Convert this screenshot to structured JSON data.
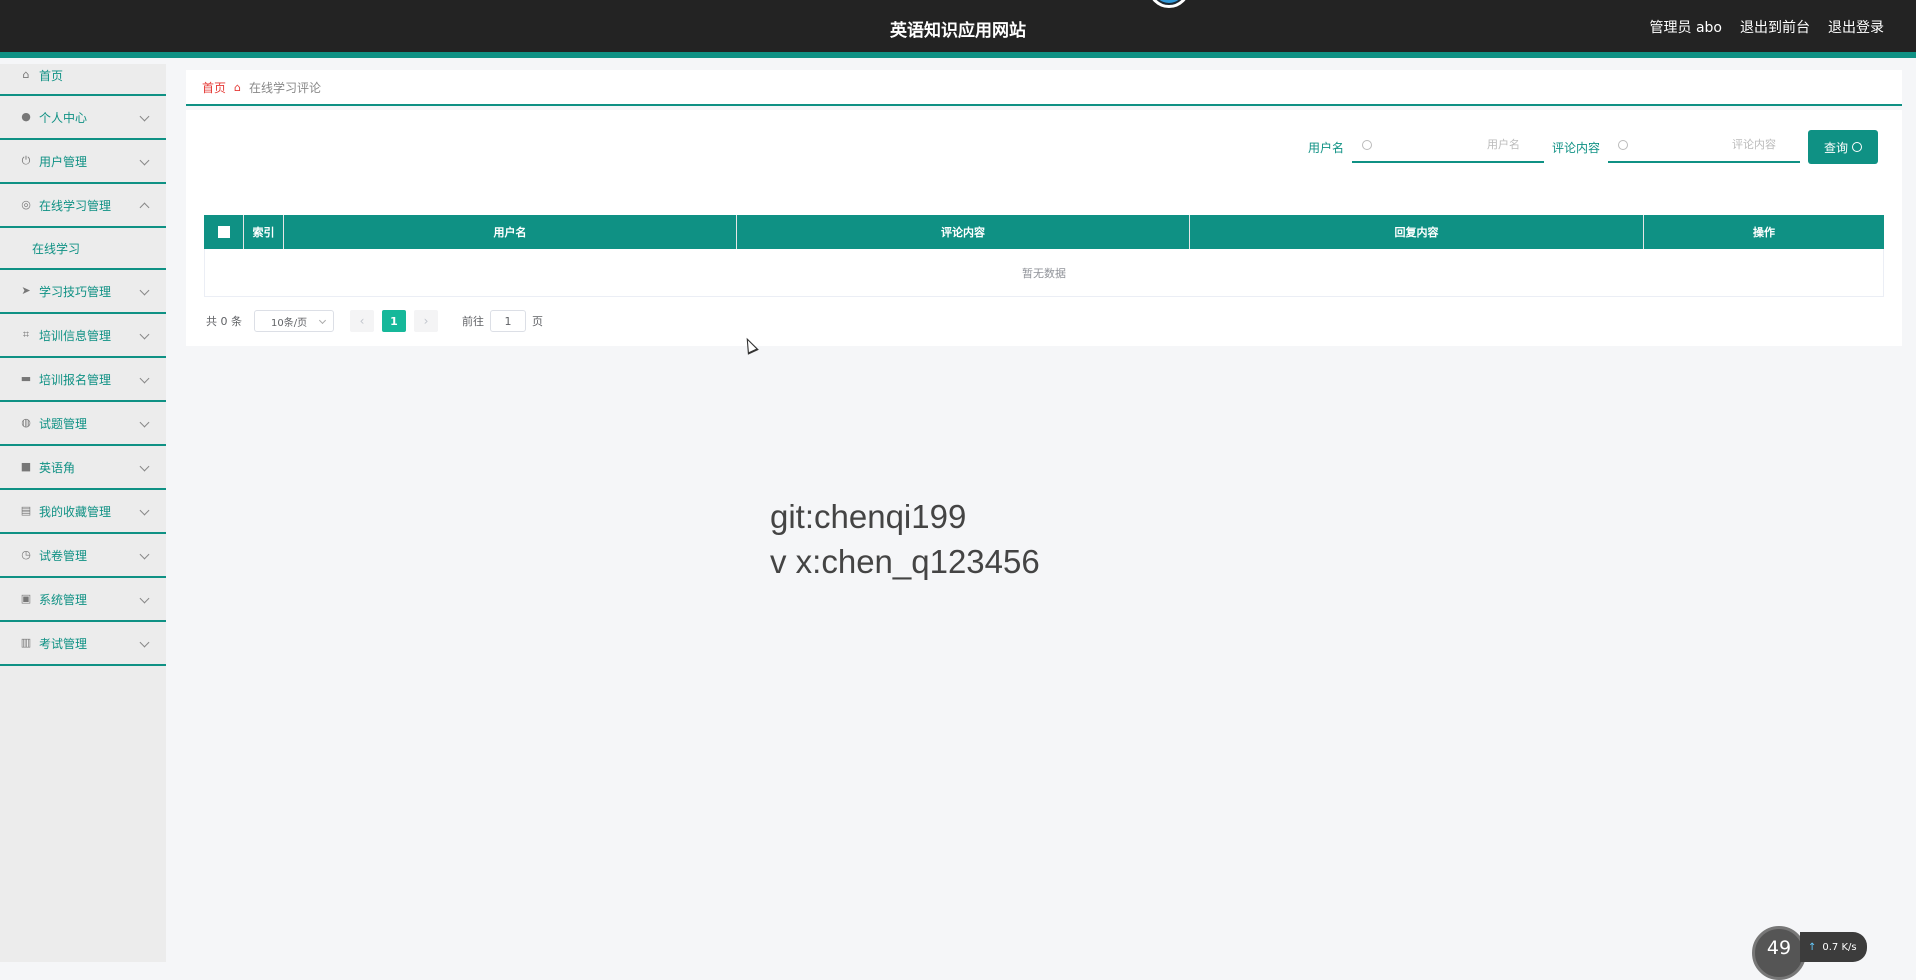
{
  "header": {
    "title": "英语知识应用网站",
    "user": "管理员 abo",
    "back_front": "退出到前台",
    "logout": "退出登录"
  },
  "sidebar": {
    "items": [
      {
        "label": "首页",
        "icon": "home-icon"
      },
      {
        "label": "个人中心",
        "icon": "user-icon"
      },
      {
        "label": "用户管理",
        "icon": "power-icon"
      },
      {
        "label": "在线学习管理",
        "icon": "compass-icon",
        "expanded": true
      },
      {
        "label": "学习技巧管理",
        "icon": "send-icon"
      },
      {
        "label": "培训信息管理",
        "icon": "crop-icon"
      },
      {
        "label": "培训报名管理",
        "icon": "chat-icon"
      },
      {
        "label": "试题管理",
        "icon": "globe-icon"
      },
      {
        "label": "英语角",
        "icon": "briefcase-icon"
      },
      {
        "label": "我的收藏管理",
        "icon": "printer-icon"
      },
      {
        "label": "试卷管理",
        "icon": "clock-icon"
      },
      {
        "label": "系统管理",
        "icon": "document-icon"
      },
      {
        "label": "考试管理",
        "icon": "clipboard-icon"
      }
    ],
    "submenu": {
      "label": "在线学习"
    }
  },
  "breadcrumb": {
    "home": "首页",
    "current": "在线学习评论"
  },
  "search": {
    "username_label": "用户名",
    "username_placeholder": "用户名",
    "comment_label": "评论内容",
    "comment_placeholder": "评论内容",
    "query_button": "查询"
  },
  "table": {
    "columns": [
      "索引",
      "用户名",
      "评论内容",
      "回复内容",
      "操作"
    ],
    "empty_text": "暂无数据"
  },
  "pagination": {
    "total": "共 0 条",
    "page_size": "10条/页",
    "current_page": "1",
    "goto_label": "前往",
    "goto_value": "1",
    "page_suffix": "页"
  },
  "watermark": {
    "line1": "git:chenqi199",
    "line2": "v x:chen_q123456"
  },
  "net_monitor": {
    "percent": "49",
    "speed": "0.7 K/s"
  },
  "colors": {
    "accent": "#0f9184",
    "header_bg": "#232323",
    "breadcrumb_home": "#e53935"
  }
}
